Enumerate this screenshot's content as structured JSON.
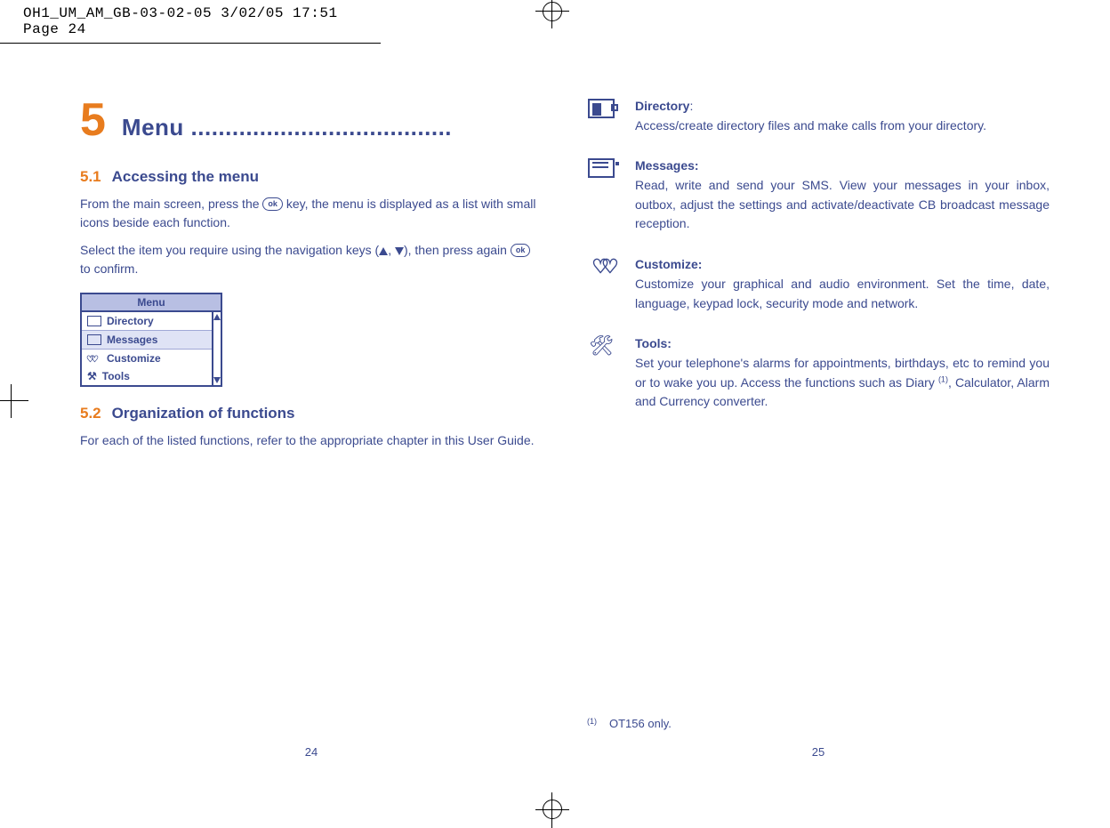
{
  "header": {
    "slug": "OH1_UM_AM_GB-03-02-05   3/02/05  17:51  Page 24"
  },
  "left": {
    "chapter_num": "5",
    "chapter_title": "Menu ......................................",
    "s1_num": "5.1",
    "s1_title": "Accessing the menu",
    "s1_p1a": "From the main screen, press the ",
    "s1_p1b": " key, the menu is displayed as a list with small icons beside each function.",
    "s1_p2a": "Select the item you require using the navigation keys (",
    "s1_p2b": ", ",
    "s1_p2c": "), then press again ",
    "s1_p2d": " to confirm.",
    "ok_label": "ok",
    "menu": {
      "title": "Menu",
      "items": [
        "Directory",
        "Messages",
        "Customize",
        "Tools"
      ],
      "selected_index": 1
    },
    "s2_num": "5.2",
    "s2_title": "Organization of functions",
    "s2_p1": "For each of the listed functions, refer to the appropriate chapter in this User Guide.",
    "page_num": "24"
  },
  "right": {
    "functions": [
      {
        "icon": "directory",
        "title": "Directory",
        "title_suffix": ":",
        "desc": "Access/create directory files and make calls from your directory."
      },
      {
        "icon": "messages",
        "title": "Messages:",
        "title_suffix": "",
        "desc": "Read, write and send your SMS. View your messages in your inbox, outbox, adjust the settings and activate/deactivate CB broadcast message reception."
      },
      {
        "icon": "customize",
        "title": "Customize:",
        "title_suffix": "",
        "desc": "Customize your graphical and audio environment. Set the time, date, language, keypad lock, security mode and network."
      },
      {
        "icon": "tools",
        "title": "Tools:",
        "title_suffix": "",
        "desc_a": "Set your telephone's alarms for appointments, birthdays, etc to remind you or to wake you up. Access the functions such as Diary ",
        "desc_sup": "(1)",
        "desc_b": ", Calculator, Alarm and Currency converter."
      }
    ],
    "footnote_mark": "(1)",
    "footnote_text": "OT156 only.",
    "page_num": "25"
  }
}
